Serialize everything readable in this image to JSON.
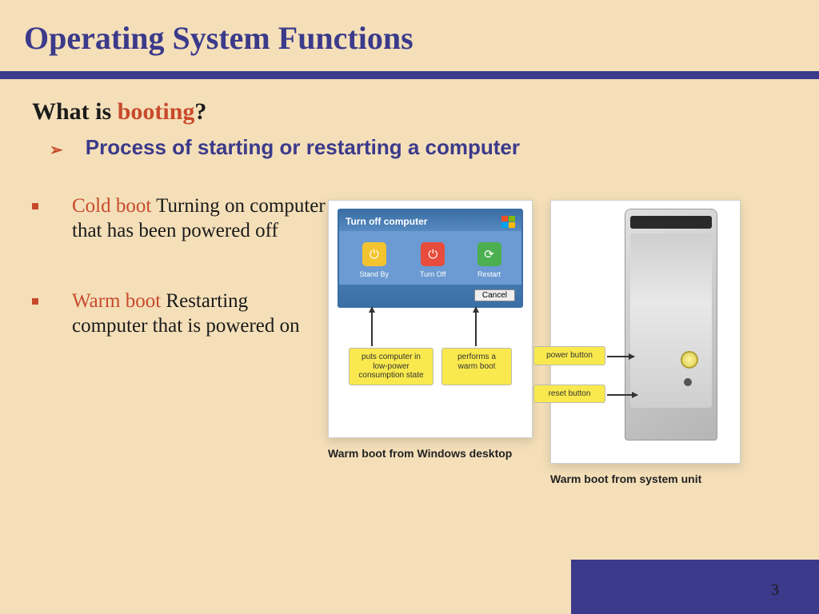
{
  "slide": {
    "title": "Operating System Functions",
    "question_prefix": "What is ",
    "question_highlight": "booting",
    "question_suffix": "?",
    "bullet_main": "Process of starting or restarting a computer",
    "cold_term": "Cold boot",
    "cold_desc": "  Turning on computer that has been powered off",
    "warm_term": "Warm boot",
    "warm_desc": "  Restarting computer that is powered on",
    "caption_left": "Warm boot from Windows desktop",
    "caption_right": "Warm boot from system unit",
    "page_number": "3"
  },
  "dialog": {
    "title": "Turn off computer",
    "standby": "Stand By",
    "turnoff": "Turn Off",
    "restart": "Restart",
    "cancel": "Cancel",
    "label_standby": "puts computer in low-power consumption state",
    "label_restart": "performs a warm boot"
  },
  "tower": {
    "label_power": "power button",
    "label_reset": "reset button"
  }
}
